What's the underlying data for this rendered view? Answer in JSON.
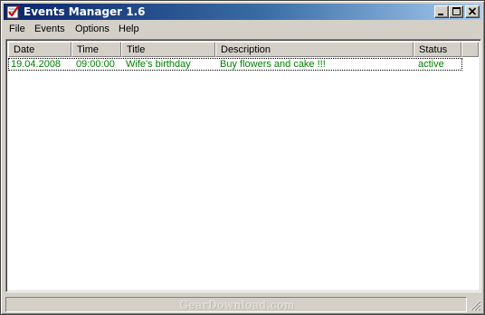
{
  "window": {
    "title": "Events Manager 1.6",
    "controls": {
      "minimize": "minimize-icon",
      "maximize": "maximize-icon",
      "close": "close-icon"
    }
  },
  "menu": {
    "items": [
      {
        "label": "File"
      },
      {
        "label": "Events"
      },
      {
        "label": "Options"
      },
      {
        "label": "Help"
      }
    ]
  },
  "table": {
    "columns": [
      {
        "label": "Date"
      },
      {
        "label": "Time"
      },
      {
        "label": "Title"
      },
      {
        "label": "Description"
      },
      {
        "label": "Status"
      }
    ],
    "rows": [
      {
        "date": "19.04.2008",
        "time": "09:00:00",
        "title": "Wife's birthday",
        "description": "Buy flowers and cake !!!",
        "status": "active"
      }
    ],
    "row_text_color": "#008000"
  },
  "statusbar": {
    "watermark": "GearDownload.com"
  },
  "colors": {
    "title_gradient_start": "#0a246a",
    "title_gradient_end": "#a6caf0",
    "face": "#d4d0c8"
  }
}
